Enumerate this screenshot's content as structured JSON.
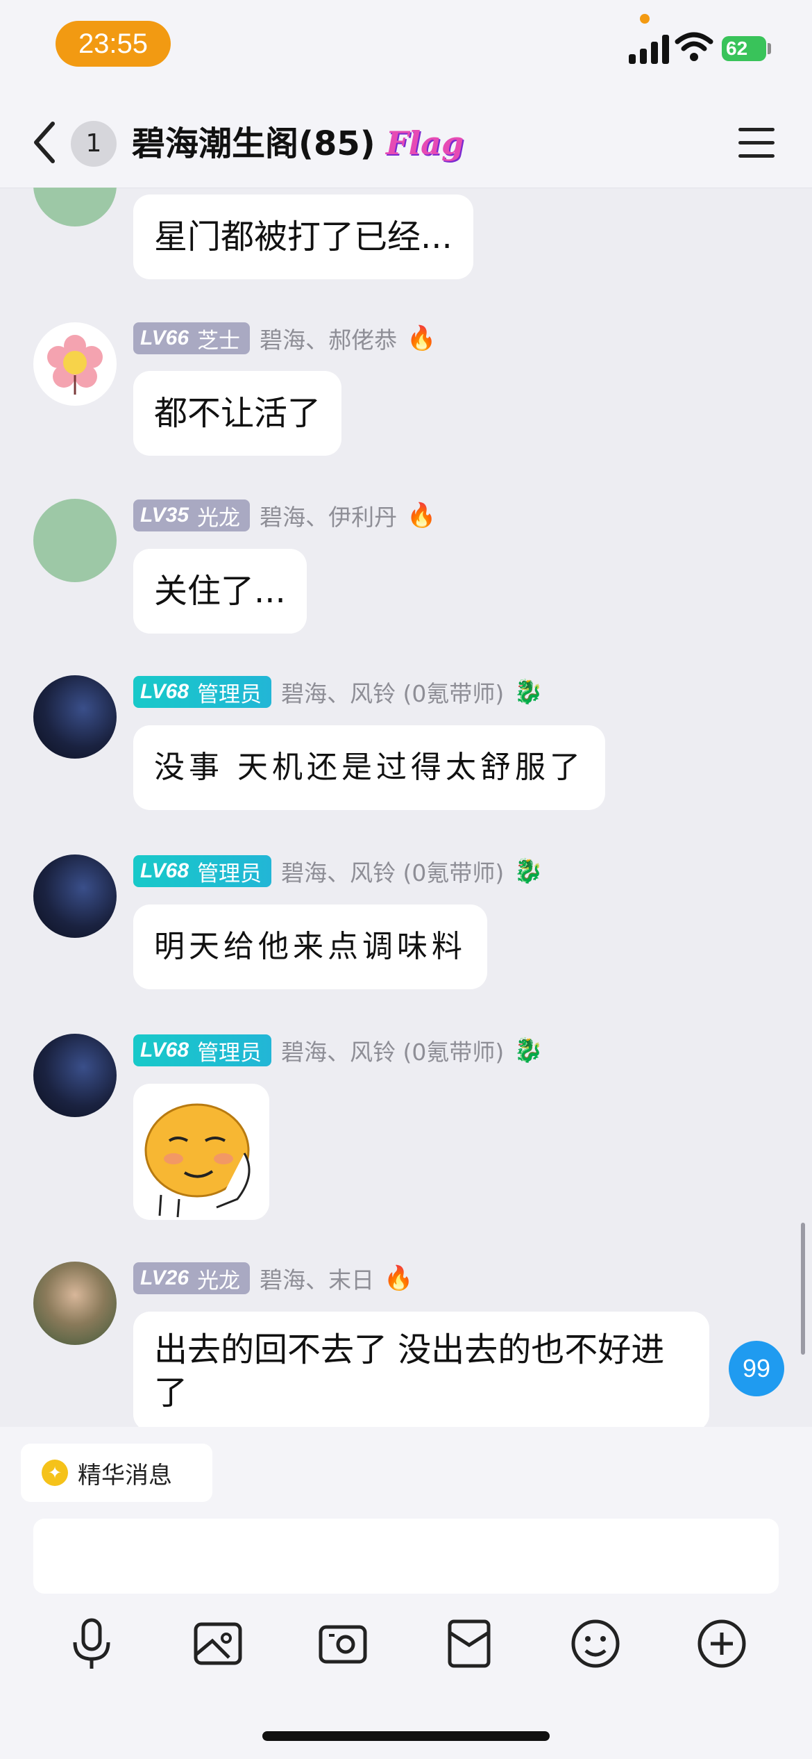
{
  "status_bar": {
    "time": "23:55",
    "battery": "62"
  },
  "header": {
    "unread_count": "1",
    "title": "碧海潮生阁(85)",
    "tag": "Flag"
  },
  "messages": [
    {
      "avatar": "line-drawing-avatar",
      "text": "星门都被打了已经..."
    },
    {
      "avatar": "flower-avatar",
      "level": "LV66",
      "title": "芝士",
      "sender": "碧海、郝佬恭",
      "text": "都不让活了"
    },
    {
      "avatar": "line-drawing-avatar",
      "level": "LV35",
      "title": "光龙",
      "sender": "碧海、伊利丹",
      "text": "关住了..."
    },
    {
      "avatar": "night-photo-avatar",
      "level": "LV68",
      "title": "管理员",
      "sender": "碧海、风铃 (0氪带师)",
      "text": "没事 天机还是过得太舒服了"
    },
    {
      "avatar": "night-photo-avatar",
      "level": "LV68",
      "title": "管理员",
      "sender": "碧海、风铃 (0氪带师)",
      "text": "明天给他来点调味料"
    },
    {
      "avatar": "night-photo-avatar",
      "level": "LV68",
      "title": "管理员",
      "sender": "碧海、风铃 (0氪带师)",
      "text": ""
    },
    {
      "avatar": "portrait-avatar",
      "level": "LV26",
      "title": "光龙",
      "sender": "碧海、末日",
      "text": "出去的回不去了 没出去的也不好进了"
    }
  ],
  "unread_badge": "99",
  "bottom": {
    "essence_label": "精华消息",
    "input_value": ""
  },
  "colors": {
    "admin_tag": "#18c9c9",
    "level_tag": "#a9a9c2",
    "unread_badge": "#1f9bf0",
    "time_pill": "#f29a12"
  }
}
